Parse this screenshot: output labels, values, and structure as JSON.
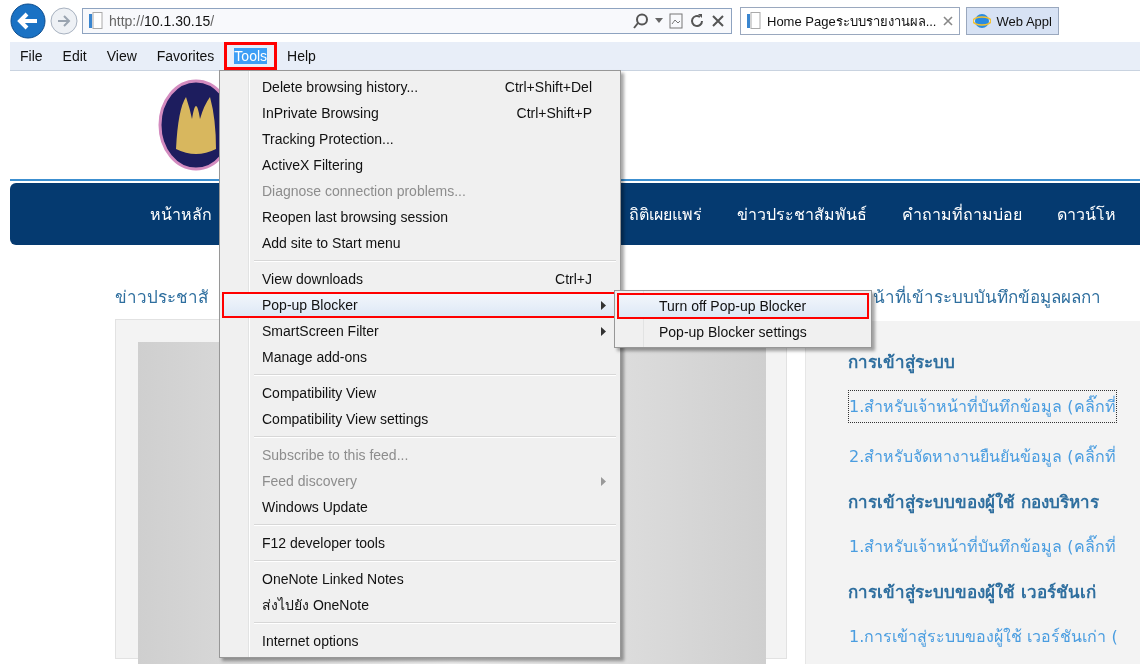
{
  "browser": {
    "url_prefix": "http://",
    "url_host": "10.1.30.15",
    "url_suffix": "/",
    "tabs": [
      {
        "label": "Home Pageระบบรายงานผล...",
        "selected": true,
        "kind": "page"
      },
      {
        "label": "Web Appl",
        "selected": false,
        "kind": "ie"
      }
    ]
  },
  "menu_bar": [
    {
      "label": "File",
      "selected": false,
      "outlined": false
    },
    {
      "label": "Edit",
      "selected": false,
      "outlined": false
    },
    {
      "label": "View",
      "selected": false,
      "outlined": false
    },
    {
      "label": "Favorites",
      "selected": false,
      "outlined": false
    },
    {
      "label": "Tools",
      "selected": true,
      "outlined": true
    },
    {
      "label": "Help",
      "selected": false,
      "outlined": false
    }
  ],
  "page": {
    "nav": [
      "หน้าหลัก",
      "ถิติเผยแพร่",
      "ข่าวประชาสัมพันธ์",
      "คำถามที่ถามบ่อย",
      "ดาวน์โห"
    ],
    "left_heading": "ข่าวประชาสั",
    "right_heading": "น้าที่เข้าระบบบันทึกข้อมูลผลกา",
    "right_items": [
      {
        "kind": "heading",
        "text": "การเข้าสู่ระบบ"
      },
      {
        "kind": "link",
        "text": "1.สำหรับเจ้าหน้าที่บันทึกข้อมูล (คลิ๊กที่",
        "focused": true
      },
      {
        "kind": "link",
        "text": "2.สำหรับจัดหางานยืนยันข้อมูล (คลิ๊กที่",
        "focused": false
      },
      {
        "kind": "heading",
        "text": "การเข้าสู่ระบบของผู้ใช้ กองบริหาร"
      },
      {
        "kind": "link",
        "text": "1.สำหรับเจ้าหน้าที่บันทึกข้อมูล (คลิ๊กที่",
        "focused": false
      },
      {
        "kind": "heading",
        "text": "การเข้าสู่ระบบของผู้ใช้ เวอร์ชันเก่"
      },
      {
        "kind": "link",
        "text": "1.การเข้าสู่ระบบของผู้ใช้ เวอร์ชันเก่า (",
        "focused": false
      }
    ]
  },
  "tools_menu": [
    {
      "kind": "item",
      "label": "Delete browsing history...",
      "shortcut": "Ctrl+Shift+Del",
      "disabled": false,
      "selected": false,
      "has_submenu": false,
      "outlined": false
    },
    {
      "kind": "item",
      "label": "InPrivate Browsing",
      "shortcut": "Ctrl+Shift+P",
      "disabled": false,
      "selected": false,
      "has_submenu": false,
      "outlined": false
    },
    {
      "kind": "item",
      "label": "Tracking Protection...",
      "disabled": false,
      "selected": false,
      "has_submenu": false,
      "outlined": false
    },
    {
      "kind": "item",
      "label": "ActiveX Filtering",
      "disabled": false,
      "selected": false,
      "has_submenu": false,
      "outlined": false
    },
    {
      "kind": "item",
      "label": "Diagnose connection problems...",
      "disabled": true,
      "selected": false,
      "has_submenu": false,
      "outlined": false
    },
    {
      "kind": "item",
      "label": "Reopen last browsing session",
      "disabled": false,
      "selected": false,
      "has_submenu": false,
      "outlined": false
    },
    {
      "kind": "item",
      "label": "Add site to Start menu",
      "disabled": false,
      "selected": false,
      "has_submenu": false,
      "outlined": false
    },
    {
      "kind": "separator"
    },
    {
      "kind": "item",
      "label": "View downloads",
      "shortcut": "Ctrl+J",
      "disabled": false,
      "selected": false,
      "has_submenu": false,
      "outlined": false
    },
    {
      "kind": "item",
      "label": "Pop-up Blocker",
      "disabled": false,
      "selected": true,
      "has_submenu": true,
      "outlined": true
    },
    {
      "kind": "item",
      "label": "SmartScreen Filter",
      "disabled": false,
      "selected": false,
      "has_submenu": true,
      "outlined": false
    },
    {
      "kind": "item",
      "label": "Manage add-ons",
      "disabled": false,
      "selected": false,
      "has_submenu": false,
      "outlined": false
    },
    {
      "kind": "separator"
    },
    {
      "kind": "item",
      "label": "Compatibility View",
      "disabled": false,
      "selected": false,
      "has_submenu": false,
      "outlined": false
    },
    {
      "kind": "item",
      "label": "Compatibility View settings",
      "disabled": false,
      "selected": false,
      "has_submenu": false,
      "outlined": false
    },
    {
      "kind": "separator"
    },
    {
      "kind": "item",
      "label": "Subscribe to this feed...",
      "disabled": true,
      "selected": false,
      "has_submenu": false,
      "outlined": false
    },
    {
      "kind": "item",
      "label": "Feed discovery",
      "disabled": true,
      "selected": false,
      "has_submenu": true,
      "outlined": false
    },
    {
      "kind": "item",
      "label": "Windows Update",
      "disabled": false,
      "selected": false,
      "has_submenu": false,
      "outlined": false
    },
    {
      "kind": "separator"
    },
    {
      "kind": "item",
      "label": "F12 developer tools",
      "disabled": false,
      "selected": false,
      "has_submenu": false,
      "outlined": false
    },
    {
      "kind": "separator"
    },
    {
      "kind": "item",
      "label": "OneNote Linked Notes",
      "disabled": false,
      "selected": false,
      "has_submenu": false,
      "outlined": false
    },
    {
      "kind": "item",
      "label": "ส่งไปยัง OneNote",
      "disabled": false,
      "selected": false,
      "has_submenu": false,
      "outlined": false
    },
    {
      "kind": "separator"
    },
    {
      "kind": "item",
      "label": "Internet options",
      "disabled": false,
      "selected": false,
      "has_submenu": false,
      "outlined": false
    }
  ],
  "popup_submenu": [
    {
      "label": "Turn off Pop-up Blocker",
      "selected": true,
      "outlined": true
    },
    {
      "label": "Pop-up Blocker settings",
      "selected": false,
      "outlined": false
    }
  ]
}
